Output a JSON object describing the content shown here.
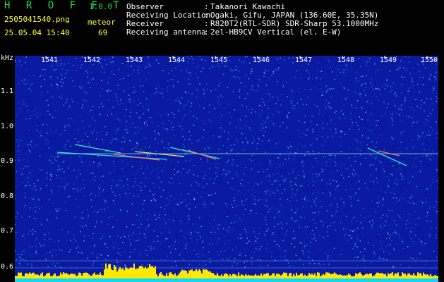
{
  "header": {
    "app_title": "H R O F F T",
    "app_version": "1.0.0",
    "file_name": "2505041540.png",
    "detection_type": "meteor",
    "datetime": "25.05.04 15:40",
    "detection_count": "69",
    "info": [
      {
        "label": "Observer",
        "value": "Takanori Kawachi"
      },
      {
        "label": "Receiving Location",
        "value": "Ogaki, Gifu, JAPAN (136.60E, 35.35N)"
      },
      {
        "label": "Receiver",
        "value": "R820T2(RTL-SDR) SDR-Sharp 53.1000MHz"
      },
      {
        "label": "Receiving antenna",
        "value": "2el-HB9CV Vertical (el. E-W)"
      }
    ]
  },
  "plot": {
    "y_unit": "kHz",
    "y_ticks": [
      "1.1",
      "1.0",
      "0.9",
      "0.8",
      "0.7",
      "0.6"
    ],
    "x_ticks": [
      "1541",
      "1542",
      "1543",
      "1544",
      "1545",
      "1546",
      "1547",
      "1548",
      "1549",
      "1550"
    ],
    "colors": {
      "background": "#0a1aa0",
      "noise": "#1e6ee8",
      "trace": "#30e8d0",
      "signal_bar": "#ffe800"
    }
  }
}
